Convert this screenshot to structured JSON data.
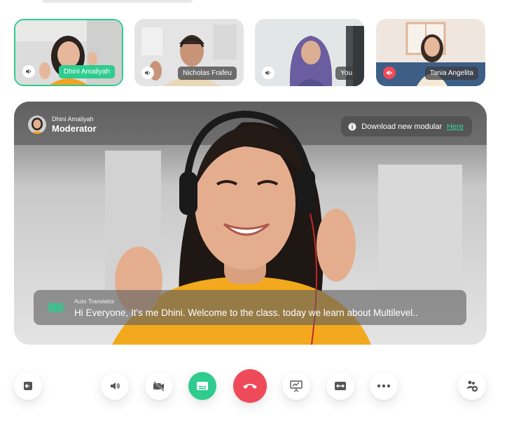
{
  "participants": [
    {
      "name": "Dhini Amaliyah",
      "speaker": "on",
      "active": true
    },
    {
      "name": "Nicholas Frafeu",
      "speaker": "on",
      "active": false
    },
    {
      "name": "You",
      "speaker": "on",
      "active": false
    },
    {
      "name": "Tania Angelita",
      "speaker": "muted",
      "active": false
    }
  ],
  "stage": {
    "moderator_name": "Dhini Amaliyah",
    "moderator_role": "Moderator",
    "download_text": "Download new modular",
    "download_link": "Here",
    "caption_label": "Auto Translator",
    "caption_text": "Hi Everyone, It's me Dhini. Welcome to the class. today we learn about Multilevel.."
  },
  "toolbar": {
    "buttons": [
      "back-icon",
      "speaker-icon",
      "camera-off-icon",
      "caption-icon",
      "end-call-icon",
      "present-icon",
      "resize-icon",
      "more-icon",
      "add-user-icon"
    ]
  },
  "colors": {
    "accent": "#2ecc8f",
    "danger": "#ef4a5a",
    "icon": "#555555"
  }
}
